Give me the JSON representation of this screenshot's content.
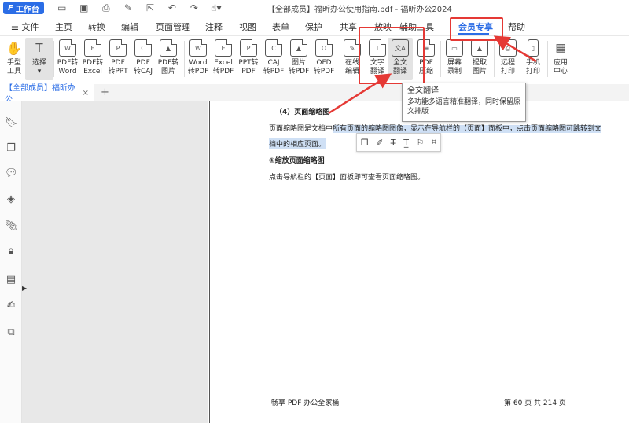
{
  "titlebar": {
    "workbench": "工作台",
    "doc_title": "【全部成员】福昕办公使用指南.pdf - 福昕办公2024"
  },
  "menu": {
    "items": [
      "文件",
      "主页",
      "转换",
      "编辑",
      "页面管理",
      "注释",
      "视图",
      "表单",
      "保护",
      "共享",
      "放映",
      "辅助工具",
      "会员专享",
      "帮助"
    ],
    "active": "会员专享"
  },
  "ribbon": {
    "tools": [
      {
        "label": "手型\n工具",
        "icon": "hand-icon"
      },
      {
        "label": "选择",
        "icon": "cursor-select-icon"
      },
      {
        "label": "PDF转\nWord",
        "icon": "W"
      },
      {
        "label": "PDF转\nExcel",
        "icon": "E"
      },
      {
        "label": "PDF\n转PPT",
        "icon": "P"
      },
      {
        "label": "PDF\n转CAJ",
        "icon": "C"
      },
      {
        "label": "PDF转\n图片",
        "icon": "img"
      },
      {
        "label": "Word\n转PDF",
        "icon": "W"
      },
      {
        "label": "Excel\n转PDF",
        "icon": "E"
      },
      {
        "label": "PPT转\nPDF",
        "icon": "P"
      },
      {
        "label": "CAJ\n转PDF",
        "icon": "C"
      },
      {
        "label": "图片\n转PDF",
        "icon": "img"
      },
      {
        "label": "OFD\n转PDF",
        "icon": "O"
      },
      {
        "label": "在线\n编辑",
        "icon": "edit"
      },
      {
        "label": "文字\n翻译",
        "icon": "T"
      },
      {
        "label": "全文\n翻译",
        "icon": "文A"
      },
      {
        "label": "PDF\n压缩",
        "icon": "zip"
      },
      {
        "label": "屏幕\n录制",
        "icon": "rec"
      },
      {
        "label": "提取\n图片",
        "icon": "img"
      },
      {
        "label": "远程\n打印",
        "icon": "pr"
      },
      {
        "label": "手机\n打印",
        "icon": "ph"
      },
      {
        "label": "应用\n中心",
        "icon": "grid"
      }
    ]
  },
  "tabbar": {
    "tab_label": "【全部成员】福昕办公...",
    "close": "×",
    "plus": "+"
  },
  "tooltip": {
    "title": "全文翻译",
    "desc": "多功能多语言精准翻译，同时保留原文排版"
  },
  "page": {
    "heading": "（4）页面缩略图",
    "para1a": "页面缩略图是文档中",
    "para1b": "所有页面的缩略图图像，显示在导航栏的【页面】面板中，点击页面缩略图可跳转到文",
    "para2": "档中的相应页面。",
    "sub": "①缩放页面缩略图",
    "para3": "点击导航栏的【页面】面板即可查看页面缩略图。",
    "footer_left": "畅享 PDF 办公全家桶",
    "footer_right": "第 60 页 共 214 页"
  }
}
